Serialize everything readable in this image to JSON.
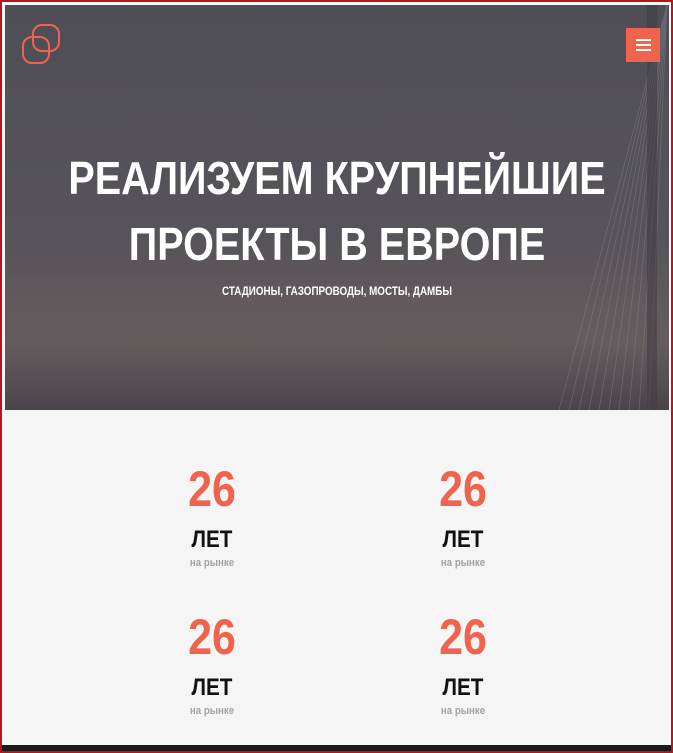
{
  "header": {
    "logo_icon": "interlocked-squares-logo-icon",
    "menu_icon": "hamburger-menu-icon",
    "accent_color": "#f0644d"
  },
  "hero": {
    "title_line1": "РЕАЛИЗУЕМ КРУПНЕЙШИЕ",
    "title_line2": "ПРОЕКТЫ В ЕВРОПЕ",
    "subtitle": "СТАДИОНЫ, ГАЗОПРОВОДЫ, МОСТЫ, ДАМБЫ"
  },
  "stats": [
    {
      "number": "26",
      "label": "ЛЕТ",
      "caption": "на рынке"
    },
    {
      "number": "26",
      "label": "ЛЕТ",
      "caption": "на рынке"
    },
    {
      "number": "26",
      "label": "ЛЕТ",
      "caption": "на рынке"
    },
    {
      "number": "26",
      "label": "ЛЕТ",
      "caption": "на рынке"
    }
  ]
}
